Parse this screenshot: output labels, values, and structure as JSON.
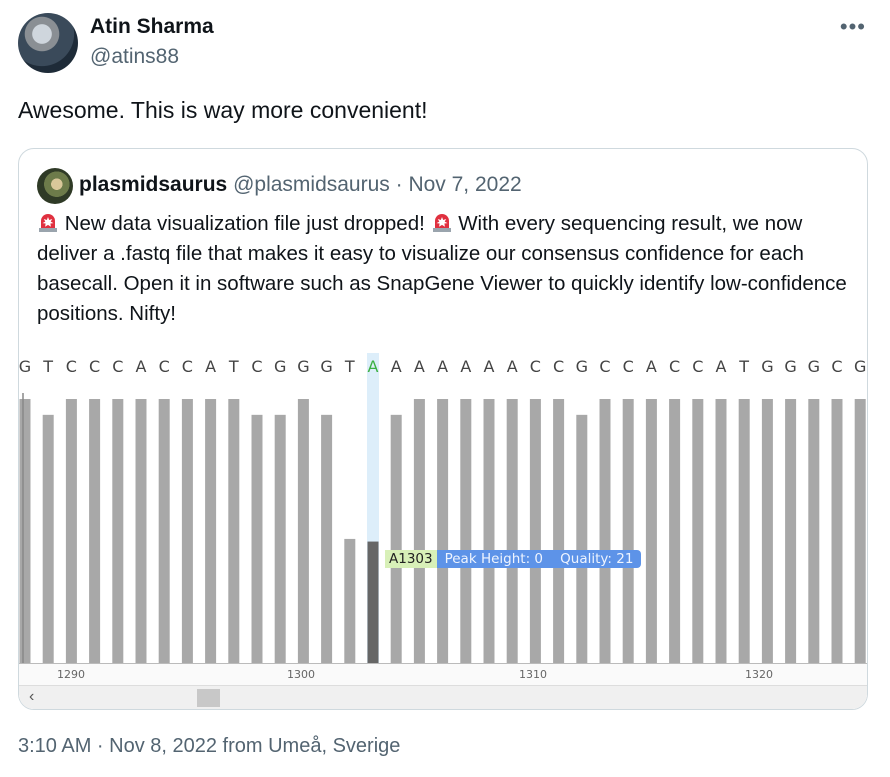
{
  "tweet": {
    "author_name": "Atin Sharma",
    "author_handle": "@atins88",
    "text": "Awesome. This is way more convenient!",
    "timestamp": "3:10 AM · Nov 8, 2022 from Umeå, Sverige",
    "more_icon": "more-horizontal-icon"
  },
  "quote": {
    "author_name": "plasmidsaurus",
    "meta": "@plasmidsaurus · Nov 7, 2022",
    "text_part1": "New data visualization file just dropped!",
    "text_part2": "With every sequencing result, we now deliver a .fastq file that makes it easy to visualize our consensus confidence for each basecall. Open it in software such as SnapGene Viewer to quickly identify low-confidence positions. Nifty!",
    "emoji": "rotating-light-icon"
  },
  "sequence_viewer": {
    "bases": [
      "G",
      "T",
      "C",
      "C",
      "C",
      "A",
      "C",
      "C",
      "A",
      "T",
      "C",
      "G",
      "G",
      "G",
      "T",
      "A",
      "A",
      "A",
      "A",
      "A",
      "A",
      "A",
      "C",
      "C",
      "G",
      "C",
      "C",
      "A",
      "C",
      "C",
      "A",
      "T",
      "G",
      "G",
      "G",
      "C",
      "G"
    ],
    "highlight_index": 15,
    "highlight_color": "#3cb043",
    "quality_fraction": [
      1.0,
      0.94,
      1.0,
      1.0,
      1.0,
      1.0,
      1.0,
      1.0,
      1.0,
      1.0,
      0.94,
      0.94,
      1.0,
      0.94,
      0.47,
      0.8,
      0.94,
      1.0,
      1.0,
      1.0,
      1.0,
      1.0,
      1.0,
      1.0,
      0.94,
      1.0,
      1.0,
      1.0,
      1.0,
      1.0,
      1.0,
      1.0,
      1.0,
      1.0,
      1.0,
      1.0,
      1.0
    ],
    "ruler_labels": [
      "1290",
      "1300",
      "1310",
      "1320"
    ],
    "tooltip": {
      "base": "A1303",
      "info": "Peak Height: 0    Quality: 21"
    },
    "scroll_left": "‹"
  }
}
